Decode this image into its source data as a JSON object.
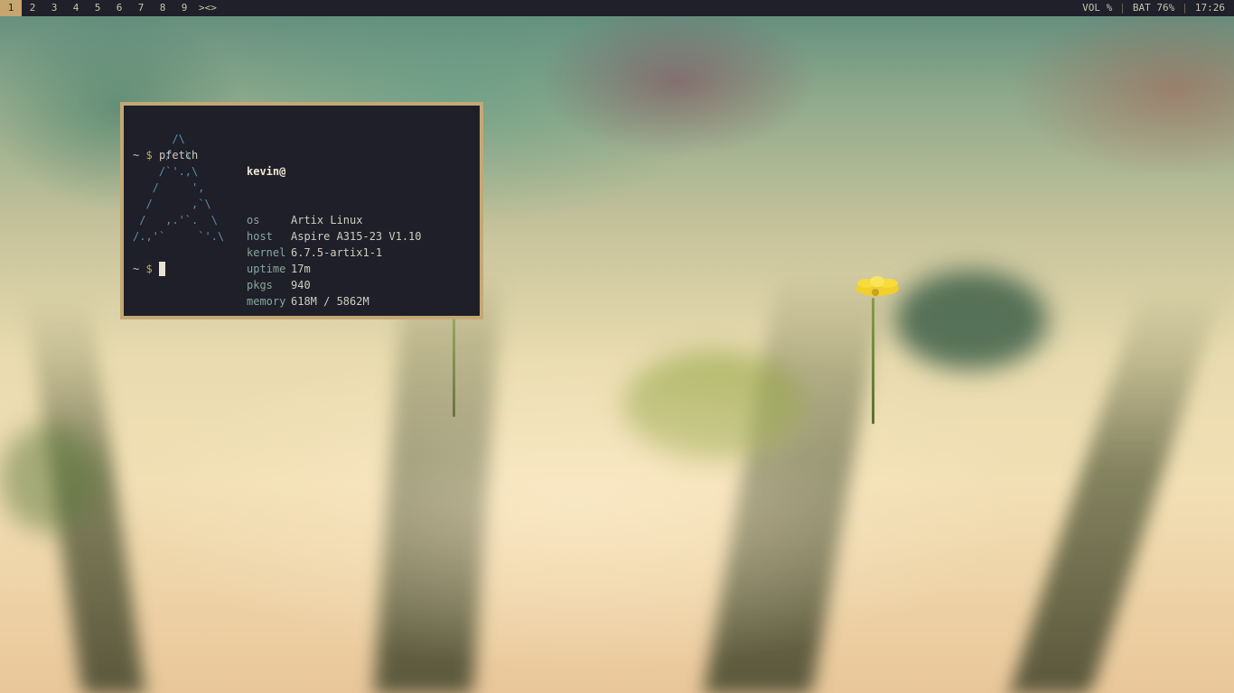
{
  "topbar": {
    "workspaces": [
      "1",
      "2",
      "3",
      "4",
      "5",
      "6",
      "7",
      "8",
      "9"
    ],
    "active_workspace": "1",
    "layout_indicator": "><>",
    "volume": "VOL %",
    "battery": "BAT 76%",
    "clock": "17:26",
    "separator": "|"
  },
  "terminal": {
    "prompt_tilde": "~",
    "prompt_dollar": "$",
    "command": "pfetch",
    "ascii_art": "      /\\\n     /  \\\n    /`'.,\\\n   /     ',\n  /      ,`\\\n /   ,.'`.  \\\n/.,'`     `'.\\",
    "user": "kevin@",
    "info": [
      {
        "key": "os",
        "value": "Artix Linux"
      },
      {
        "key": "host",
        "value": "Aspire A315-23 V1.10"
      },
      {
        "key": "kernel",
        "value": "6.7.5-artix1-1"
      },
      {
        "key": "uptime",
        "value": "17m"
      },
      {
        "key": "pkgs",
        "value": "940"
      },
      {
        "key": "memory",
        "value": "618M / 5862M"
      }
    ]
  },
  "colors": {
    "bar_bg": "#1f2029",
    "accent": "#c6a56e",
    "terminal_bg": "#1e1f29",
    "terminal_border": "#c4a874",
    "art_color": "#5f8fa6",
    "key_color": "#88a79a"
  }
}
